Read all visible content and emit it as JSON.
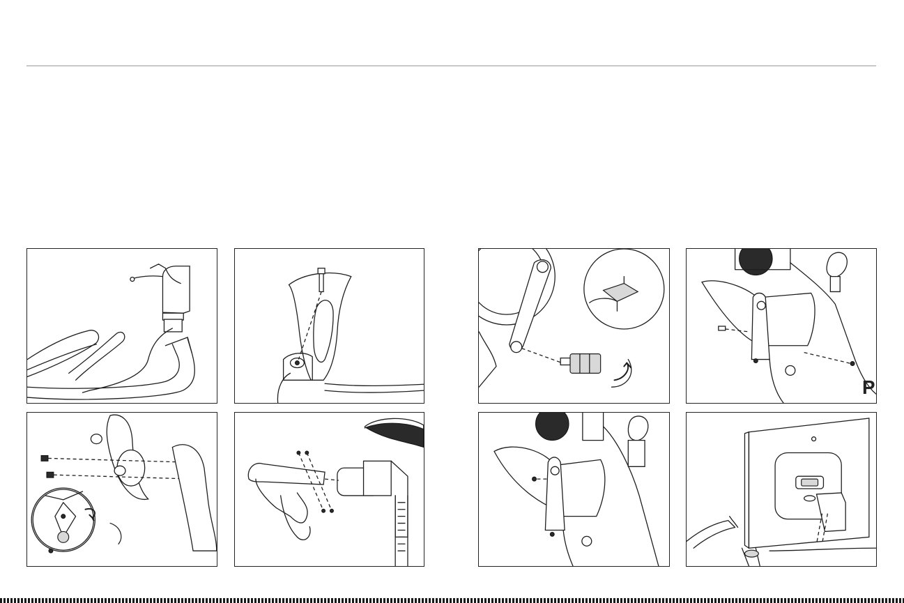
{
  "document": {
    "panels": [
      {
        "id": "power-cable-routing",
        "icon": "power-cable-illustration"
      },
      {
        "id": "seat-post-bolt",
        "icon": "seat-post-bolt-illustration"
      },
      {
        "id": "pedal-attachment",
        "icon": "pedal-attachment-illustration"
      },
      {
        "id": "front-cover-screws",
        "icon": "front-cover-screw-illustration"
      },
      {
        "id": "water-bottle-holder",
        "icon": "bottle-holder-illustration"
      },
      {
        "id": "seat-rail-assembly",
        "icon": "seat-rail-illustration"
      },
      {
        "id": "front-cover-final",
        "icon": "front-cover-final-illustration"
      },
      {
        "id": "touchscreen-mount",
        "icon": "touchscreen-mount-illustration"
      }
    ]
  }
}
